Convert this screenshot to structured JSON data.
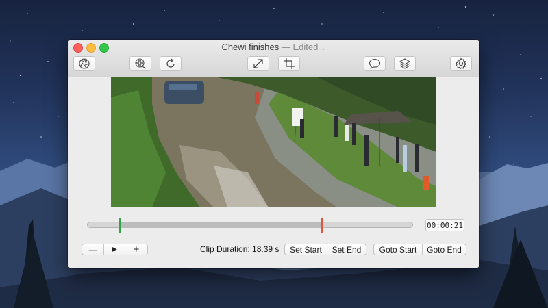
{
  "window": {
    "title": "Chewi finishes",
    "separator": "—",
    "status": "Edited",
    "title_menu_icon": "chevron-down-icon"
  },
  "toolbar": {
    "buttons": [
      {
        "name": "aperture-button",
        "icon": "aperture-icon"
      },
      {
        "name": "film-reel-button",
        "icon": "film-reel-icon"
      },
      {
        "name": "rotate-button",
        "icon": "rotate-icon"
      },
      {
        "name": "resize-button",
        "icon": "expand-arrows-icon"
      },
      {
        "name": "crop-button",
        "icon": "crop-icon"
      },
      {
        "name": "comment-button",
        "icon": "speech-bubble-icon"
      },
      {
        "name": "layers-button",
        "icon": "layers-icon"
      },
      {
        "name": "settings-button",
        "icon": "gear-icon"
      }
    ]
  },
  "timeline": {
    "clip_start_fraction": 0.1,
    "clip_end_fraction": 0.72,
    "start_marker_color": "#2fa548",
    "end_marker_color": "#e2553a",
    "timecode": "00:00:21"
  },
  "controls": {
    "zoom_out": "—",
    "play": "▶",
    "zoom_in": "+",
    "clip_duration_label": "Clip Duration:",
    "clip_duration_value": "18.39 s",
    "set_start": "Set Start",
    "set_end": "Set End",
    "goto_start": "Goto Start",
    "goto_end": "Goto End"
  }
}
